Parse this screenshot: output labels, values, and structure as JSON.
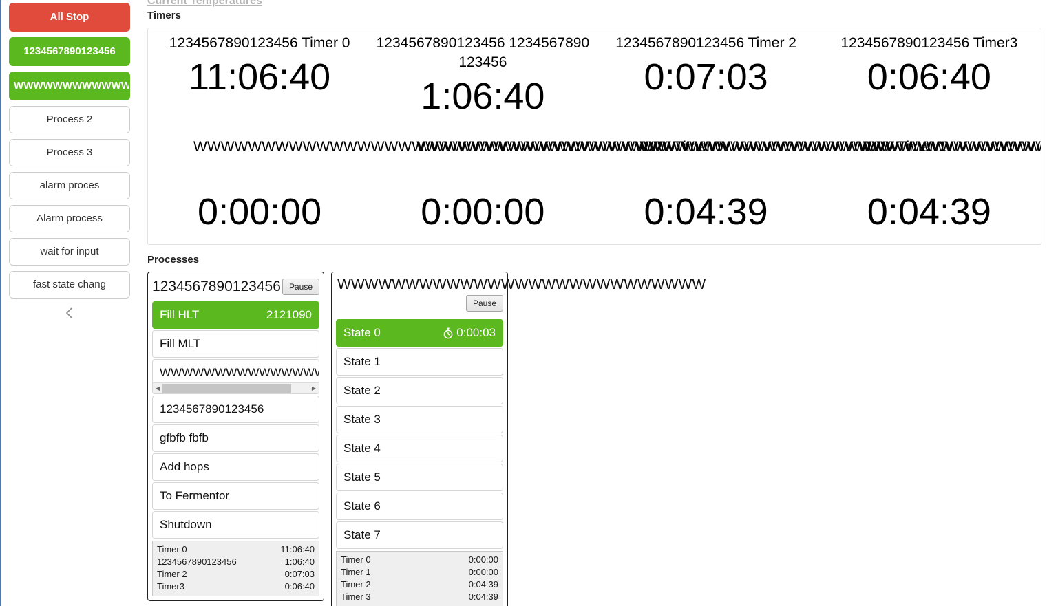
{
  "sidebar": {
    "buttons": [
      {
        "label": "All Stop",
        "style": "stop"
      },
      {
        "label": "1234567890123456",
        "style": "running"
      },
      {
        "label": "WWWWWWWWWWWWWWWWWWWWWW",
        "style": "running"
      },
      {
        "label": "Process 2",
        "style": "plain"
      },
      {
        "label": "Process 3",
        "style": "plain"
      },
      {
        "label": "alarm proces",
        "style": "plain"
      },
      {
        "label": "Alarm process",
        "style": "plain"
      },
      {
        "label": "wait for input",
        "style": "plain"
      },
      {
        "label": "fast state chang",
        "style": "plain"
      }
    ],
    "collapse_icon": "chevron-left-icon"
  },
  "header": {
    "temperatures_link": "Current Temperatures"
  },
  "timers_section": {
    "title": "Timers",
    "cells": [
      {
        "label": "1234567890123456 Timer 0",
        "value": "11:06:40"
      },
      {
        "label": "1234567890123456 1234567890123456",
        "value": "1:06:40"
      },
      {
        "label": "1234567890123456 Timer 2",
        "value": "0:07:03"
      },
      {
        "label": "1234567890123456 Timer3",
        "value": "0:06:40"
      },
      {
        "label": "WWWWWWWWWWWWWWWWWWWWWWWWWWWWWWWWWWW Timer 0",
        "value": "0:00:00"
      },
      {
        "label": "WWWWWWWWWWWWWWWWWWWWWWWWWWWWWWWWWWW Timer 1",
        "value": "0:00:00"
      },
      {
        "label": "WWWWWWWWWWWWWWWWWWWWWWWWWWWWWWWWWWW Timer 2",
        "value": "0:04:39"
      },
      {
        "label": "WWWWWWWWWWWWWWWWWWWWWWWWWWWWWWWWWWW Timer 3",
        "value": "0:04:39"
      }
    ],
    "overlay_rows": [
      {
        "w_text": "WWWWWWWWWWWWWWWWWWWWWWWWWWWWWWWWWWWWWWWWWWWWWWWWWWWWWWWWWWWWWWWWWWWWWWWWWWWWWWWWWWWWWWWWWWWWWWWWWWWWWWWWWWWWWWWWWWWWWWWWWWWWWWWWWWWWWWWWWWWWWWWWWWWWWWWWWWWWWWWWWWWWWWWWWWWWWWWWWWWWWWWWWWWWWWWWWWWWWWWWWWW",
        "labels": [
          "Timer 0",
          "Timer 1",
          "Timer 2",
          "Timer 3"
        ]
      }
    ]
  },
  "processes_section": {
    "title": "Processes",
    "cards": [
      {
        "title": "1234567890123456",
        "title_overflows": false,
        "pause_label": "Pause",
        "states": [
          {
            "name": "Fill HLT",
            "value": "2121090",
            "active": true,
            "scrollable": false,
            "has_timer_icon": false
          },
          {
            "name": "Fill MLT",
            "value": "",
            "active": false,
            "scrollable": false,
            "has_timer_icon": false
          },
          {
            "name": "WWWWWWWWWWWWWWWWWWWWWWWWWWWWWWWWWWWWWW",
            "value": "",
            "active": false,
            "scrollable": true,
            "has_timer_icon": false
          },
          {
            "name": "1234567890123456",
            "value": "",
            "active": false,
            "scrollable": false,
            "has_timer_icon": false
          },
          {
            "name": "gfbfb fbfb",
            "value": "",
            "active": false,
            "scrollable": false,
            "has_timer_icon": false
          },
          {
            "name": "Add hops",
            "value": "",
            "active": false,
            "scrollable": false,
            "has_timer_icon": false
          },
          {
            "name": "To Fermentor",
            "value": "",
            "active": false,
            "scrollable": false,
            "has_timer_icon": false
          },
          {
            "name": "Shutdown",
            "value": "",
            "active": false,
            "scrollable": false,
            "has_timer_icon": false
          }
        ],
        "timers": [
          {
            "name": "Timer 0",
            "value": "11:06:40"
          },
          {
            "name": "1234567890123456",
            "value": "1:06:40"
          },
          {
            "name": "Timer 2",
            "value": "0:07:03"
          },
          {
            "name": "Timer3",
            "value": "0:06:40"
          }
        ]
      },
      {
        "title": "WWWWWWWWWWWWWWWWWWWWWWWWWWW",
        "title_overflows": true,
        "pause_label": "Pause",
        "states": [
          {
            "name": "State 0",
            "value": "0:00:03",
            "active": true,
            "scrollable": false,
            "has_timer_icon": true
          },
          {
            "name": "State 1",
            "value": "",
            "active": false,
            "scrollable": false,
            "has_timer_icon": false
          },
          {
            "name": "State 2",
            "value": "",
            "active": false,
            "scrollable": false,
            "has_timer_icon": false
          },
          {
            "name": "State 3",
            "value": "",
            "active": false,
            "scrollable": false,
            "has_timer_icon": false
          },
          {
            "name": "State 4",
            "value": "",
            "active": false,
            "scrollable": false,
            "has_timer_icon": false
          },
          {
            "name": "State 5",
            "value": "",
            "active": false,
            "scrollable": false,
            "has_timer_icon": false
          },
          {
            "name": "State 6",
            "value": "",
            "active": false,
            "scrollable": false,
            "has_timer_icon": false
          },
          {
            "name": "State 7",
            "value": "",
            "active": false,
            "scrollable": false,
            "has_timer_icon": false
          }
        ],
        "timers": [
          {
            "name": "Timer 0",
            "value": "0:00:00"
          },
          {
            "name": "Timer 1",
            "value": "0:00:00"
          },
          {
            "name": "Timer 2",
            "value": "0:04:39"
          },
          {
            "name": "Timer 3",
            "value": "0:04:39"
          }
        ]
      }
    ]
  },
  "colors": {
    "stop_red": "#e04b3b",
    "running_green": "#5cb81f",
    "sidebar_border": "#4e79a8",
    "timer_list_bg": "#efefef"
  }
}
